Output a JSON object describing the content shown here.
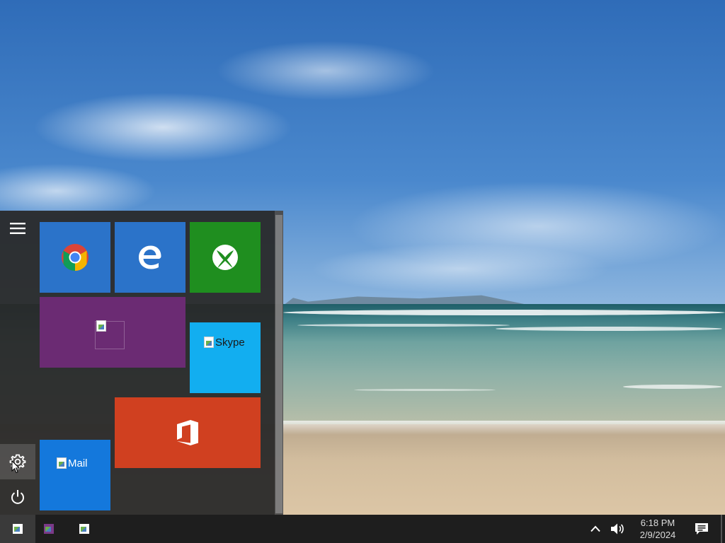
{
  "desktop": {
    "wallpaper": "beach-seascape"
  },
  "start_menu": {
    "sidebar": {
      "menu_icon": "hamburger-icon",
      "settings_icon": "gear-icon",
      "power_icon": "power-icon"
    },
    "tiles": {
      "chrome": {
        "icon": "chrome-icon",
        "color": "#2b73c9"
      },
      "edge": {
        "icon": "edge-icon",
        "color": "#2b73c9"
      },
      "xbox": {
        "icon": "xbox-icon",
        "color": "#1f8e1f"
      },
      "purple": {
        "icon": "broken-image-icon",
        "color": "#6b2b73"
      },
      "skype": {
        "alt_text": "Skype",
        "color": "#12aef0"
      },
      "office": {
        "icon": "office-icon",
        "color": "#d04020"
      },
      "mail": {
        "alt_text": "Mail",
        "color": "#1478dc"
      }
    }
  },
  "taskbar": {
    "start_icon": "broken-image-icon",
    "apps": [
      {
        "icon": "broken-image-icon"
      },
      {
        "icon": "broken-image-icon"
      }
    ],
    "tray": {
      "chevron_icon": "chevron-up-icon",
      "volume_icon": "volume-icon"
    },
    "clock": {
      "time": "6:18 PM",
      "date": "2/9/2024"
    },
    "notification_icon": "notification-icon"
  }
}
